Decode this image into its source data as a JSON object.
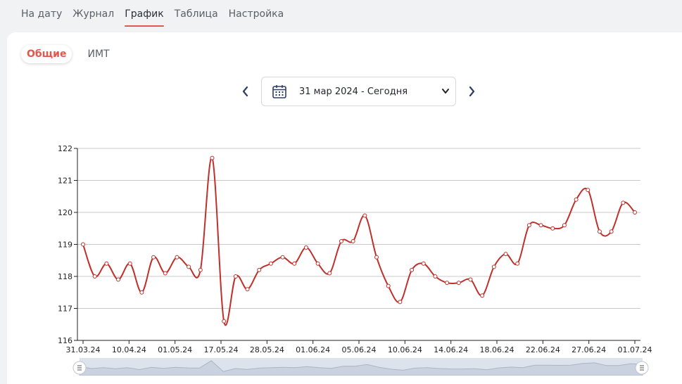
{
  "nav": {
    "tabs": [
      {
        "label": "На дату"
      },
      {
        "label": "Журнал"
      },
      {
        "label": "График"
      },
      {
        "label": "Таблица"
      },
      {
        "label": "Настройка"
      }
    ],
    "active_index": 2
  },
  "subtabs": {
    "items": [
      {
        "label": "Общие"
      },
      {
        "label": "ИМТ"
      }
    ],
    "active_index": 0
  },
  "date_picker": {
    "selected": "31 мар 2024 - Сегодня"
  },
  "colors": {
    "accent": "#e2574c",
    "line": "#c0302b",
    "nav_arrow": "#2c3e66"
  },
  "chart_data": {
    "type": "line",
    "x": [
      "31.03.24",
      "04.04.24",
      "06.04.24",
      "08.04.24",
      "10.04.24",
      "12.04.24",
      "14.04.24",
      "16.04.24",
      "19.04.24",
      "22.04.24",
      "25.04.24",
      "28.04.24",
      "01.05.24",
      "04.05.24",
      "07.05.24",
      "10.05.24",
      "13.05.24",
      "16.05.24",
      "17.05.24",
      "18.05.24",
      "20.05.24",
      "22.05.24",
      "24.05.24",
      "26.05.24",
      "28.05.24",
      "30.05.24",
      "31.05.24",
      "01.06.24",
      "02.06.24",
      "03.06.24",
      "04.06.24",
      "05.06.24",
      "06.06.24",
      "07.06.24",
      "08.06.24",
      "09.06.24",
      "10.06.24",
      "11.06.24",
      "12.06.24",
      "13.06.24",
      "14.06.24",
      "15.06.24",
      "16.06.24",
      "17.06.24",
      "18.06.24",
      "19.06.24",
      "20.06.24",
      "21.06.24",
      "22.06.24",
      "23.06.24",
      "24.06.24",
      "25.06.24",
      "26.06.24",
      "27.06.24",
      "28.06.24",
      "29.06.24",
      "30.06.24",
      "01.07.24"
    ],
    "values": [
      119.0,
      118.0,
      118.4,
      117.9,
      118.4,
      117.5,
      118.6,
      118.1,
      118.6,
      118.3,
      118.2,
      121.7,
      116.6,
      118.0,
      117.6,
      118.2,
      118.4,
      118.6,
      118.4,
      118.9,
      118.4,
      118.1,
      119.1,
      119.1,
      119.9,
      118.6,
      117.7,
      117.2,
      118.2,
      118.4,
      118.0,
      117.8,
      117.8,
      117.9,
      117.4,
      118.3,
      118.7,
      118.4,
      119.6,
      119.6,
      119.5,
      119.6,
      120.4,
      120.7,
      119.4,
      119.4,
      120.3,
      120.0
    ],
    "xticks": [
      "31.03.24",
      "10.04.24",
      "01.05.24",
      "17.05.24",
      "28.05.24",
      "01.06.24",
      "05.06.24",
      "10.06.24",
      "14.06.24",
      "18.06.24",
      "22.06.24",
      "27.06.24",
      "01.07.24"
    ],
    "yticks": [
      116,
      117,
      118,
      119,
      120,
      121,
      122
    ],
    "ylim": [
      116,
      122
    ],
    "grid": true,
    "legend": "none"
  }
}
